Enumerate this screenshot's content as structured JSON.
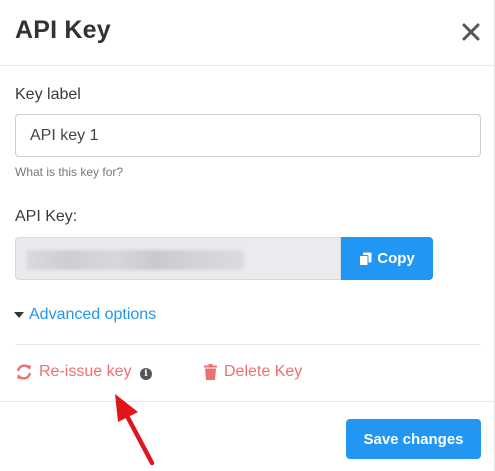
{
  "dialog": {
    "title": "API Key",
    "close_icon": "close-icon"
  },
  "key_label": {
    "label": "Key label",
    "value": "API key 1",
    "hint": "What is this key for?"
  },
  "api_key": {
    "label": "API Key:",
    "copy_label": "Copy",
    "copy_icon": "copy-icon"
  },
  "advanced": {
    "label": "Advanced options"
  },
  "actions": {
    "reissue_label": "Re-issue key",
    "reissue_icon": "refresh-icon",
    "info_icon": "info-icon",
    "delete_label": "Delete Key",
    "delete_icon": "trash-icon"
  },
  "footer": {
    "save_label": "Save changes"
  },
  "annotation": {
    "arrow_color": "#e0161a"
  },
  "colors": {
    "primary": "#2196f3",
    "danger": "#ef6f6f"
  }
}
